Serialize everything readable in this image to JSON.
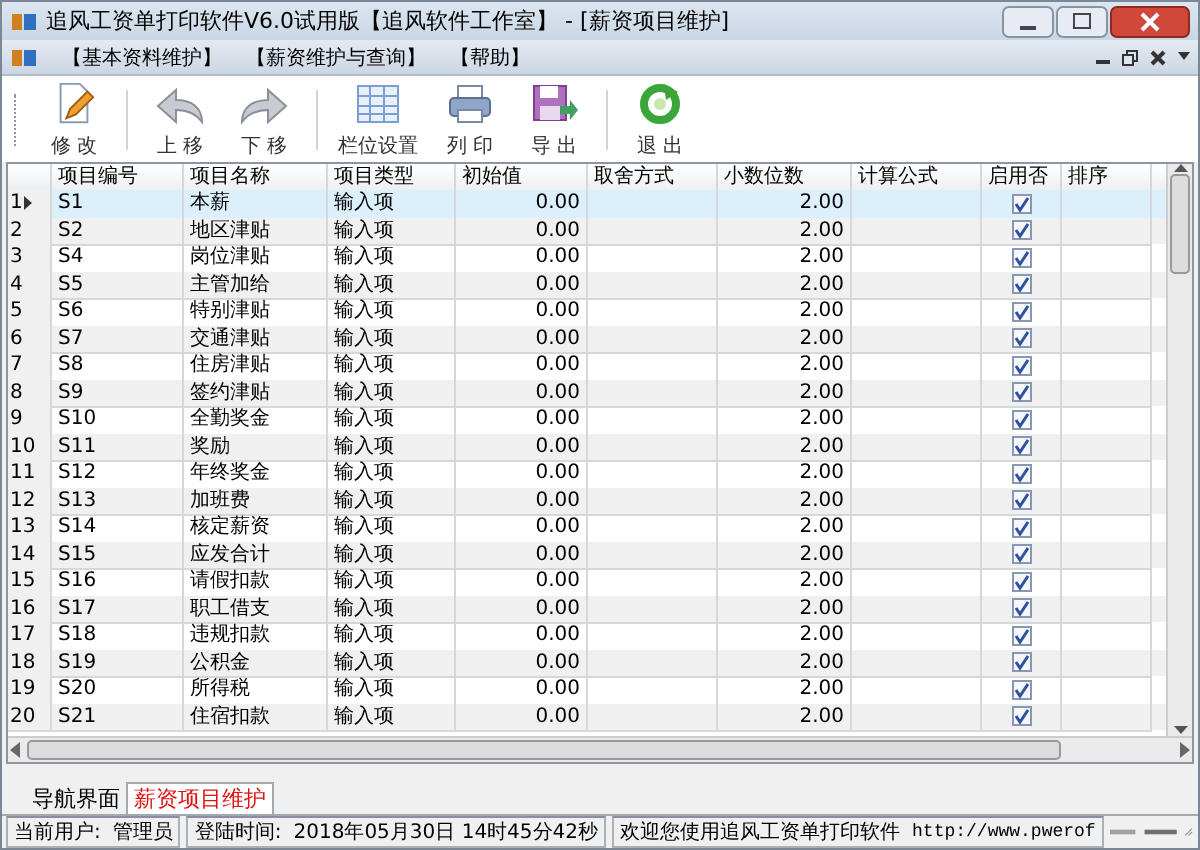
{
  "window": {
    "title": "追风工资单打印软件V6.0试用版【追风软件工作室】 - [薪资项目维护]"
  },
  "menu": [
    {
      "label": "【基本资料维护】"
    },
    {
      "label": "【薪资维护与查询】"
    },
    {
      "label": "【帮助】"
    }
  ],
  "toolbar": [
    {
      "label": "修 改",
      "kind": "edit"
    },
    {
      "kind": "separator"
    },
    {
      "label": "上 移",
      "kind": "up"
    },
    {
      "label": "下 移",
      "kind": "down"
    },
    {
      "kind": "separator"
    },
    {
      "label": "栏位设置",
      "kind": "columns"
    },
    {
      "label": "列 印",
      "kind": "print"
    },
    {
      "label": "导 出",
      "kind": "export"
    },
    {
      "kind": "separator"
    },
    {
      "label": "退 出",
      "kind": "exit"
    }
  ],
  "table": {
    "columns": [
      "项目编号",
      "项目名称",
      "项目类型",
      "初始值",
      "取舍方式",
      "小数位数",
      "计算公式",
      "启用否",
      "排序"
    ],
    "rows": [
      {
        "number": "1",
        "selected": true,
        "code": "S1",
        "name": "本薪",
        "type": "输入项",
        "initial": "0.00",
        "decimals": "2.00",
        "enabled": true
      },
      {
        "number": "2",
        "selected": false,
        "code": "S2",
        "name": "地区津贴",
        "type": "输入项",
        "initial": "0.00",
        "decimals": "2.00",
        "enabled": true
      },
      {
        "number": "3",
        "selected": false,
        "code": "S4",
        "name": "岗位津贴",
        "type": "输入项",
        "initial": "0.00",
        "decimals": "2.00",
        "enabled": true
      },
      {
        "number": "4",
        "selected": false,
        "code": "S5",
        "name": "主管加给",
        "type": "输入项",
        "initial": "0.00",
        "decimals": "2.00",
        "enabled": true
      },
      {
        "number": "5",
        "selected": false,
        "code": "S6",
        "name": "特别津贴",
        "type": "输入项",
        "initial": "0.00",
        "decimals": "2.00",
        "enabled": true
      },
      {
        "number": "6",
        "selected": false,
        "code": "S7",
        "name": "交通津贴",
        "type": "输入项",
        "initial": "0.00",
        "decimals": "2.00",
        "enabled": true
      },
      {
        "number": "7",
        "selected": false,
        "code": "S8",
        "name": "住房津贴",
        "type": "输入项",
        "initial": "0.00",
        "decimals": "2.00",
        "enabled": true
      },
      {
        "number": "8",
        "selected": false,
        "code": "S9",
        "name": "签约津贴",
        "type": "输入项",
        "initial": "0.00",
        "decimals": "2.00",
        "enabled": true
      },
      {
        "number": "9",
        "selected": false,
        "code": "S10",
        "name": "全勤奖金",
        "type": "输入项",
        "initial": "0.00",
        "decimals": "2.00",
        "enabled": true
      },
      {
        "number": "10",
        "selected": false,
        "code": "S11",
        "name": "奖励",
        "type": "输入项",
        "initial": "0.00",
        "decimals": "2.00",
        "enabled": true
      },
      {
        "number": "11",
        "selected": false,
        "code": "S12",
        "name": "年终奖金",
        "type": "输入项",
        "initial": "0.00",
        "decimals": "2.00",
        "enabled": true
      },
      {
        "number": "12",
        "selected": false,
        "code": "S13",
        "name": "加班费",
        "type": "输入项",
        "initial": "0.00",
        "decimals": "2.00",
        "enabled": true
      },
      {
        "number": "13",
        "selected": false,
        "code": "S14",
        "name": "核定薪资",
        "type": "输入项",
        "initial": "0.00",
        "decimals": "2.00",
        "enabled": true
      },
      {
        "number": "14",
        "selected": false,
        "code": "S15",
        "name": "应发合计",
        "type": "输入项",
        "initial": "0.00",
        "decimals": "2.00",
        "enabled": true
      },
      {
        "number": "15",
        "selected": false,
        "code": "S16",
        "name": "请假扣款",
        "type": "输入项",
        "initial": "0.00",
        "decimals": "2.00",
        "enabled": true
      },
      {
        "number": "16",
        "selected": false,
        "code": "S17",
        "name": "职工借支",
        "type": "输入项",
        "initial": "0.00",
        "decimals": "2.00",
        "enabled": true
      },
      {
        "number": "17",
        "selected": false,
        "code": "S18",
        "name": "违规扣款",
        "type": "输入项",
        "initial": "0.00",
        "decimals": "2.00",
        "enabled": true
      },
      {
        "number": "18",
        "selected": false,
        "code": "S19",
        "name": "公积金",
        "type": "输入项",
        "initial": "0.00",
        "decimals": "2.00",
        "enabled": true
      },
      {
        "number": "19",
        "selected": false,
        "code": "S20",
        "name": "所得税",
        "type": "输入项",
        "initial": "0.00",
        "decimals": "2.00",
        "enabled": true
      },
      {
        "number": "20",
        "selected": false,
        "code": "S21",
        "name": "住宿扣款",
        "type": "输入项",
        "initial": "0.00",
        "decimals": "2.00",
        "enabled": true
      }
    ]
  },
  "tabs": [
    {
      "label": "导航界面",
      "selected": false
    },
    {
      "label": "薪资项目维护",
      "selected": true
    }
  ],
  "status_bar": {
    "user_label": "当前用户:",
    "user": "管理员",
    "login_label": "登陆时间:",
    "login_time": "2018年05月30日 14时45分42秒",
    "welcome": "欢迎您使用追风工资单打印软件",
    "url": "http://www.pwerof"
  }
}
